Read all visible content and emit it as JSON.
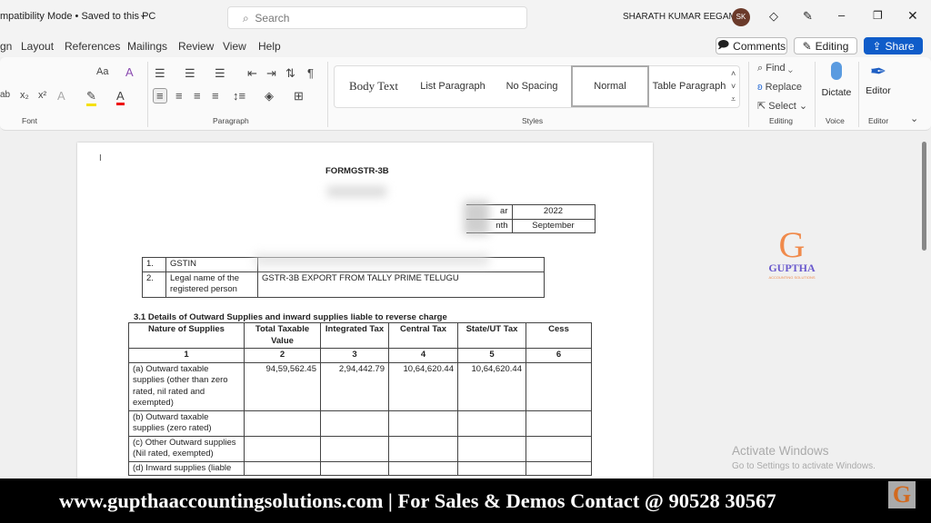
{
  "titlebar": {
    "doc_status": "mpatibility Mode • Saved to this PC",
    "search_placeholder": "Search",
    "user": "SHARATH KUMAR EEGAM",
    "avatar": "SK"
  },
  "tabs": [
    "gn",
    "Layout",
    "References",
    "Mailings",
    "Review",
    "View",
    "Help"
  ],
  "actions": {
    "comments": "Comments",
    "editing": "Editing",
    "share": "Share"
  },
  "ribbon": {
    "groups": {
      "font": "Font",
      "paragraph": "Paragraph",
      "styles": "Styles",
      "editing": "Editing",
      "voice": "Voice",
      "editor": "Editor"
    },
    "styles": [
      "Body Text",
      "List Paragraph",
      "No Spacing",
      "Normal",
      "Table Paragraph"
    ],
    "find": "Find",
    "replace": "Replace",
    "select": "Select",
    "dictate": "Dictate",
    "editor": "Editor",
    "change_case": "Aa"
  },
  "doc": {
    "title": "FORMGSTR-3B",
    "year_label": "ar",
    "year": "2022",
    "month_label": "nth",
    "month": "September",
    "info": [
      {
        "no": "1.",
        "label": "GSTIN",
        "value": ""
      },
      {
        "no": "2.",
        "label": "Legal name of the registered person",
        "value": "GSTR-3B  EXPORT FROM TALLY PRIME TELUGU"
      }
    ],
    "section": "3.1  Details of Outward Supplies and inward supplies liable to reverse charge",
    "headers": [
      "Nature of Supplies",
      "Total Taxable Value",
      "Integrated Tax",
      "Central Tax",
      "State/UT Tax",
      "Cess"
    ],
    "numbers": [
      "1",
      "2",
      "3",
      "4",
      "5",
      "6"
    ],
    "rows": [
      [
        "(a) Outward taxable supplies (other than zero rated, nil rated and exempted)",
        "94,59,562.45",
        "2,94,442.79",
        "10,64,620.44",
        "10,64,620.44",
        ""
      ],
      [
        "(b) Outward taxable supplies (zero rated)",
        "",
        "",
        "",
        "",
        ""
      ],
      [
        "(c) Other Outward supplies (Nil rated, exempted)",
        "",
        "",
        "",
        "",
        ""
      ],
      [
        "(d) Inward supplies (liable",
        "",
        "",
        "",
        "",
        ""
      ]
    ]
  },
  "logo": {
    "name": "GUPTHA",
    "tagline": "ACCOUNTING SOLUTIONS"
  },
  "watermark": {
    "title": "Activate Windows",
    "sub": "Go to Settings to activate Windows."
  },
  "footer": "www.gupthaaccountingsolutions.com | For Sales & Demos Contact @ 90528 30567",
  "colors": {
    "share": "#0f5cc9",
    "avatar": "#6b3a2a",
    "logo_orange": "#f08a4b",
    "logo_purple": "#6a5acd"
  }
}
